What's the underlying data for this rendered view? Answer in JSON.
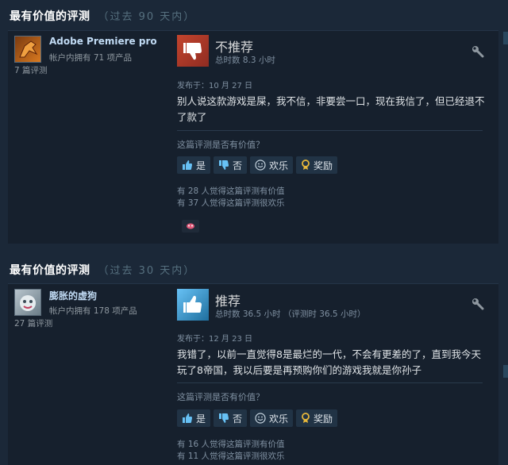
{
  "reviews": [
    {
      "section_title": "最有价值的评测",
      "section_period": "（过去 90 天内）",
      "author": {
        "name": "Adobe Premiere pro",
        "owned": "帐户内拥有 71 项产品",
        "reviews": "7 篇评测"
      },
      "verdict": "不推荐",
      "hours": "总时数 8.3 小时",
      "posted": "发布于：10 月 27 日",
      "text": "别人说这款游戏是屎，我不信，非要尝一口，现在我信了，但已经退不了款了",
      "helpful_question": "这篇评测是否有价值？",
      "buttons": {
        "yes": "是",
        "no": "否",
        "funny": "欢乐",
        "award": "奖励"
      },
      "stat_helpful": "有 28 人觉得这篇评测有价值",
      "stat_funny": "有 37 人觉得这篇评测很欢乐"
    },
    {
      "section_title": "最有价值的评测",
      "section_period": "（过去 30 天内）",
      "author": {
        "name": "膨胀的虚狗",
        "owned": "帐户内拥有 178 项产品",
        "reviews": "27 篇评测"
      },
      "verdict": "推荐",
      "hours": "总时数 36.5 小时 （评测时 36.5 小时）",
      "posted": "发布于：12 月 23 日",
      "text": "我错了，以前一直觉得8是最烂的一代，不会有更差的了，直到我今天玩了8帝国，我以后要是再预购你们的游戏我就是你孙子",
      "helpful_question": "这篇评测是否有价值？",
      "buttons": {
        "yes": "是",
        "no": "否",
        "funny": "欢乐",
        "award": "奖励"
      },
      "stat_helpful": "有 16 人觉得这篇评测有价值",
      "stat_funny": "有 11 人觉得这篇评测很欢乐"
    }
  ],
  "colors": {
    "background": "#1b2838",
    "panel": "#16202d",
    "negative": "#c3442d",
    "positive": "#67c1f5",
    "link": "#c1dbf4"
  }
}
